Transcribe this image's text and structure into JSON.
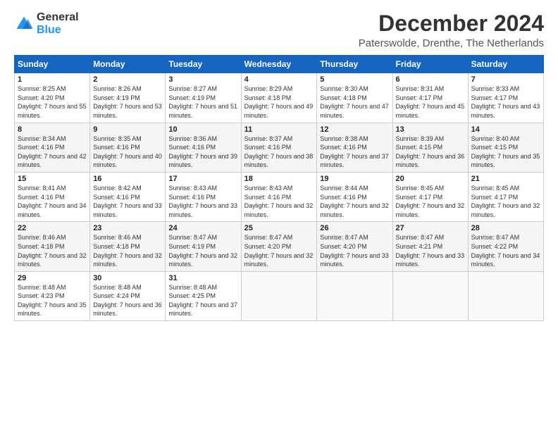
{
  "header": {
    "logo_general": "General",
    "logo_blue": "Blue",
    "month_year": "December 2024",
    "location": "Paterswolde, Drenthe, The Netherlands"
  },
  "days_of_week": [
    "Sunday",
    "Monday",
    "Tuesday",
    "Wednesday",
    "Thursday",
    "Friday",
    "Saturday"
  ],
  "weeks": [
    [
      {
        "day": "1",
        "sunrise": "8:25 AM",
        "sunset": "4:20 PM",
        "daylight": "7 hours and 55 minutes."
      },
      {
        "day": "2",
        "sunrise": "8:26 AM",
        "sunset": "4:19 PM",
        "daylight": "7 hours and 53 minutes."
      },
      {
        "day": "3",
        "sunrise": "8:27 AM",
        "sunset": "4:19 PM",
        "daylight": "7 hours and 51 minutes."
      },
      {
        "day": "4",
        "sunrise": "8:29 AM",
        "sunset": "4:18 PM",
        "daylight": "7 hours and 49 minutes."
      },
      {
        "day": "5",
        "sunrise": "8:30 AM",
        "sunset": "4:18 PM",
        "daylight": "7 hours and 47 minutes."
      },
      {
        "day": "6",
        "sunrise": "8:31 AM",
        "sunset": "4:17 PM",
        "daylight": "7 hours and 45 minutes."
      },
      {
        "day": "7",
        "sunrise": "8:33 AM",
        "sunset": "4:17 PM",
        "daylight": "7 hours and 43 minutes."
      }
    ],
    [
      {
        "day": "8",
        "sunrise": "8:34 AM",
        "sunset": "4:16 PM",
        "daylight": "7 hours and 42 minutes."
      },
      {
        "day": "9",
        "sunrise": "8:35 AM",
        "sunset": "4:16 PM",
        "daylight": "7 hours and 40 minutes."
      },
      {
        "day": "10",
        "sunrise": "8:36 AM",
        "sunset": "4:16 PM",
        "daylight": "7 hours and 39 minutes."
      },
      {
        "day": "11",
        "sunrise": "8:37 AM",
        "sunset": "4:16 PM",
        "daylight": "7 hours and 38 minutes."
      },
      {
        "day": "12",
        "sunrise": "8:38 AM",
        "sunset": "4:16 PM",
        "daylight": "7 hours and 37 minutes."
      },
      {
        "day": "13",
        "sunrise": "8:39 AM",
        "sunset": "4:15 PM",
        "daylight": "7 hours and 36 minutes."
      },
      {
        "day": "14",
        "sunrise": "8:40 AM",
        "sunset": "4:15 PM",
        "daylight": "7 hours and 35 minutes."
      }
    ],
    [
      {
        "day": "15",
        "sunrise": "8:41 AM",
        "sunset": "4:16 PM",
        "daylight": "7 hours and 34 minutes."
      },
      {
        "day": "16",
        "sunrise": "8:42 AM",
        "sunset": "4:16 PM",
        "daylight": "7 hours and 33 minutes."
      },
      {
        "day": "17",
        "sunrise": "8:43 AM",
        "sunset": "4:16 PM",
        "daylight": "7 hours and 33 minutes."
      },
      {
        "day": "18",
        "sunrise": "8:43 AM",
        "sunset": "4:16 PM",
        "daylight": "7 hours and 32 minutes."
      },
      {
        "day": "19",
        "sunrise": "8:44 AM",
        "sunset": "4:16 PM",
        "daylight": "7 hours and 32 minutes."
      },
      {
        "day": "20",
        "sunrise": "8:45 AM",
        "sunset": "4:17 PM",
        "daylight": "7 hours and 32 minutes."
      },
      {
        "day": "21",
        "sunrise": "8:45 AM",
        "sunset": "4:17 PM",
        "daylight": "7 hours and 32 minutes."
      }
    ],
    [
      {
        "day": "22",
        "sunrise": "8:46 AM",
        "sunset": "4:18 PM",
        "daylight": "7 hours and 32 minutes."
      },
      {
        "day": "23",
        "sunrise": "8:46 AM",
        "sunset": "4:18 PM",
        "daylight": "7 hours and 32 minutes."
      },
      {
        "day": "24",
        "sunrise": "8:47 AM",
        "sunset": "4:19 PM",
        "daylight": "7 hours and 32 minutes."
      },
      {
        "day": "25",
        "sunrise": "8:47 AM",
        "sunset": "4:20 PM",
        "daylight": "7 hours and 32 minutes."
      },
      {
        "day": "26",
        "sunrise": "8:47 AM",
        "sunset": "4:20 PM",
        "daylight": "7 hours and 33 minutes."
      },
      {
        "day": "27",
        "sunrise": "8:47 AM",
        "sunset": "4:21 PM",
        "daylight": "7 hours and 33 minutes."
      },
      {
        "day": "28",
        "sunrise": "8:47 AM",
        "sunset": "4:22 PM",
        "daylight": "7 hours and 34 minutes."
      }
    ],
    [
      {
        "day": "29",
        "sunrise": "8:48 AM",
        "sunset": "4:23 PM",
        "daylight": "7 hours and 35 minutes."
      },
      {
        "day": "30",
        "sunrise": "8:48 AM",
        "sunset": "4:24 PM",
        "daylight": "7 hours and 36 minutes."
      },
      {
        "day": "31",
        "sunrise": "8:48 AM",
        "sunset": "4:25 PM",
        "daylight": "7 hours and 37 minutes."
      },
      null,
      null,
      null,
      null
    ]
  ]
}
